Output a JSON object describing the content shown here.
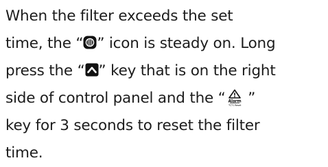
{
  "paragraph": {
    "l1": "When the filter exceeds the set",
    "l2a": "time, the “",
    "l2b": "” icon is steady on. Long",
    "l3a": "press the “",
    "l3b": "” key that is on the right",
    "l4a": "side of control panel and the “",
    "l4b": " ”",
    "l5": "key for 3 seconds to reset the filter",
    "l6": "time."
  },
  "icons": {
    "filter": "filter-icon",
    "up": "up-arrow-key-icon",
    "alarm": "alarm-key-icon",
    "alarm_text": "Alarm",
    "alarm_subtext": "°F/°C Reset"
  }
}
